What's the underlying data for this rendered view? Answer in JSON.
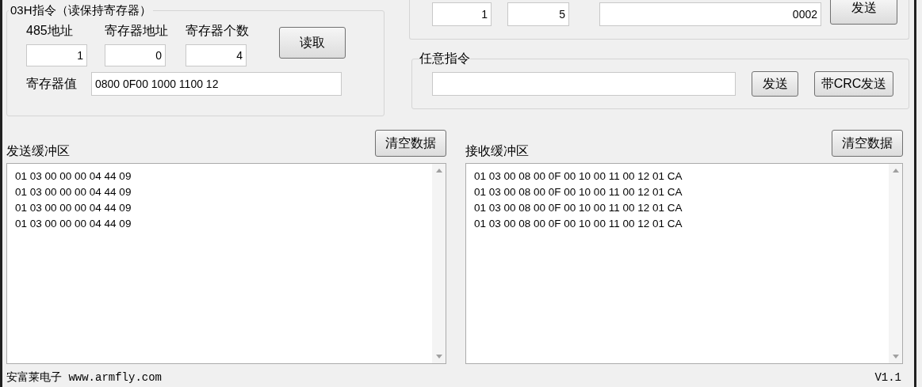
{
  "read_holding": {
    "title": "03H指令（读保持寄存器）",
    "fields": [
      {
        "label": "485地址",
        "value": "1"
      },
      {
        "label": "寄存器地址",
        "value": "0"
      },
      {
        "label": "寄存器个数",
        "value": "4"
      }
    ],
    "read_button": "读取",
    "value_label": "寄存器值",
    "value": "0800 0F00 1000 1100 12"
  },
  "write_group": {
    "fields": [
      "1",
      "5",
      "0002"
    ],
    "send_button": "发送"
  },
  "custom": {
    "title": "任意指令",
    "send_button": "发送",
    "crc_button": "带CRC发送"
  },
  "buffers": [
    {
      "title": "发送缓冲区",
      "clear_button": "清空数据",
      "lines": [
        "01 03 00 00 00 04 44 09",
        "01 03 00 00 00 04 44 09",
        "01 03 00 00 00 04 44 09",
        "01 03 00 00 00 04 44 09"
      ]
    },
    {
      "title": "接收缓冲区",
      "clear_button": "清空数据",
      "lines": [
        "01 03 00 08 00 0F 00 10 00 11 00 12 01 CA",
        "01 03 00 08 00 0F 00 10 00 11 00 12 01 CA",
        "01 03 00 08 00 0F 00 10 00 11 00 12 01 CA",
        "01 03 00 08 00 0F 00 10 00 11 00 12 01 CA"
      ]
    }
  ],
  "status_bar": {
    "left": "安富莱电子 www.armfly.com",
    "right": "V1.1"
  }
}
